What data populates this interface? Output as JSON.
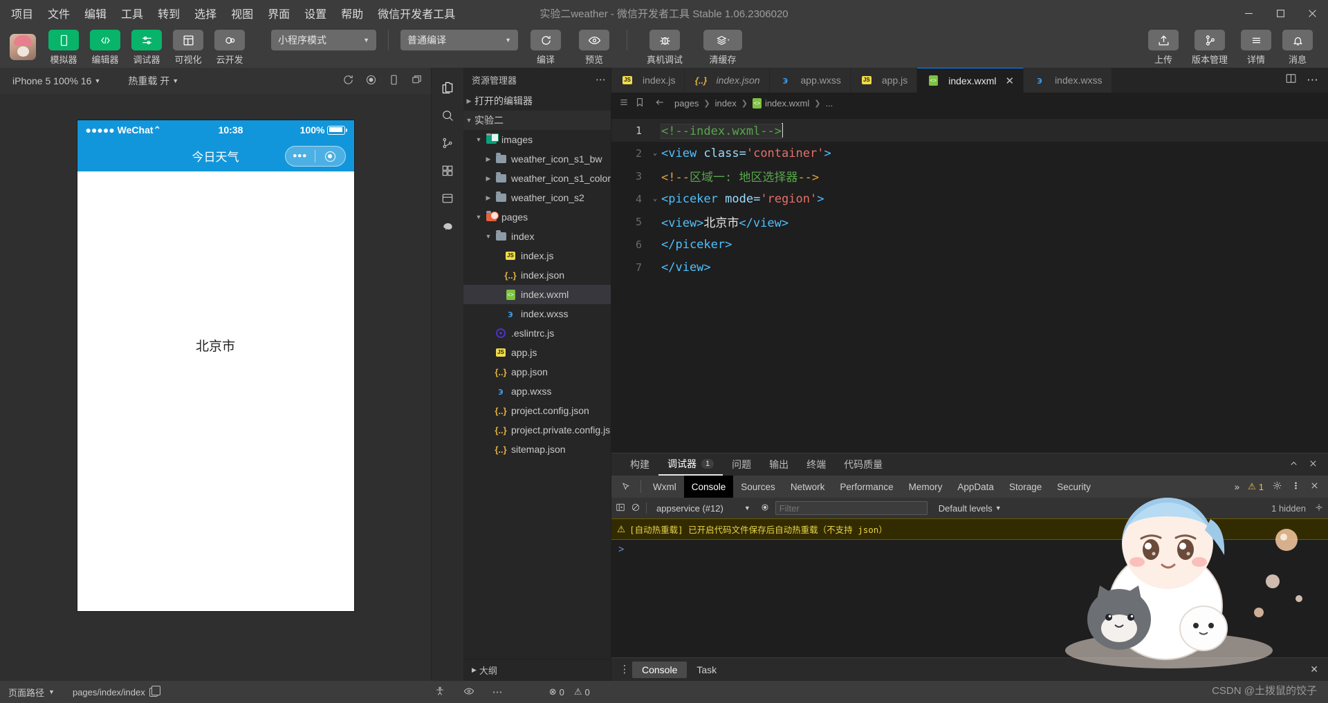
{
  "titlebar": {
    "menu": [
      "项目",
      "文件",
      "编辑",
      "工具",
      "转到",
      "选择",
      "视图",
      "界面",
      "设置",
      "帮助",
      "微信开发者工具"
    ],
    "title": "实验二weather - 微信开发者工具 Stable 1.06.2306020"
  },
  "toolbar": {
    "left_buttons": [
      {
        "label": "模拟器",
        "icon": "phone-icon",
        "style": "green"
      },
      {
        "label": "编辑器",
        "icon": "code-icon",
        "style": "green"
      },
      {
        "label": "调试器",
        "icon": "sliders-icon",
        "style": "green"
      },
      {
        "label": "可视化",
        "icon": "layout-icon",
        "style": "grey"
      },
      {
        "label": "云开发",
        "icon": "cloud-icon",
        "style": "grey"
      }
    ],
    "mode_select": "小程序模式",
    "compile_select": "普通编译",
    "action_buttons": [
      {
        "label": "编译",
        "icon": "refresh-icon"
      },
      {
        "label": "预览",
        "icon": "eye-icon"
      },
      {
        "label": "真机调试",
        "icon": "bug-icon"
      },
      {
        "label": "清缓存",
        "icon": "layers-icon"
      }
    ],
    "right_buttons": [
      {
        "label": "上传",
        "icon": "upload-icon"
      },
      {
        "label": "版本管理",
        "icon": "branch-icon"
      },
      {
        "label": "详情",
        "icon": "menu-icon"
      },
      {
        "label": "消息",
        "icon": "bell-icon"
      }
    ]
  },
  "simulator": {
    "device": "iPhone 5 100% 16",
    "hotreload": "热重载 开",
    "status_time": "10:38",
    "carrier": "WeChat",
    "battery": "100%",
    "nav_title": "今日天气",
    "page_text": "北京市"
  },
  "explorer": {
    "header": "资源管理器",
    "open_editors": "打开的编辑器",
    "project": "实验二",
    "outline": "大纲",
    "tree": [
      {
        "label": "images",
        "type": "folder-images",
        "depth": 1,
        "arrow": "down"
      },
      {
        "label": "weather_icon_s1_bw",
        "type": "folder",
        "depth": 2,
        "arrow": "right"
      },
      {
        "label": "weather_icon_s1_color",
        "type": "folder",
        "depth": 2,
        "arrow": "right"
      },
      {
        "label": "weather_icon_s2",
        "type": "folder",
        "depth": 2,
        "arrow": "right"
      },
      {
        "label": "pages",
        "type": "folder-pages",
        "depth": 1,
        "arrow": "down"
      },
      {
        "label": "index",
        "type": "folder-open",
        "depth": 2,
        "arrow": "down"
      },
      {
        "label": "index.js",
        "type": "js",
        "depth": 3,
        "arrow": "none"
      },
      {
        "label": "index.json",
        "type": "json",
        "depth": 3,
        "arrow": "none"
      },
      {
        "label": "index.wxml",
        "type": "wxml",
        "depth": 3,
        "arrow": "none",
        "selected": true
      },
      {
        "label": "index.wxss",
        "type": "wxss",
        "depth": 3,
        "arrow": "none"
      },
      {
        "label": ".eslintrc.js",
        "type": "eslint",
        "depth": 2,
        "arrow": "none"
      },
      {
        "label": "app.js",
        "type": "js",
        "depth": 2,
        "arrow": "none"
      },
      {
        "label": "app.json",
        "type": "json",
        "depth": 2,
        "arrow": "none"
      },
      {
        "label": "app.wxss",
        "type": "wxss",
        "depth": 2,
        "arrow": "none"
      },
      {
        "label": "project.config.json",
        "type": "json",
        "depth": 2,
        "arrow": "none"
      },
      {
        "label": "project.private.config.js...",
        "type": "json",
        "depth": 2,
        "arrow": "none"
      },
      {
        "label": "sitemap.json",
        "type": "json",
        "depth": 2,
        "arrow": "none"
      }
    ]
  },
  "editor": {
    "tabs": [
      {
        "label": "index.js",
        "type": "js",
        "active": false,
        "italic": false
      },
      {
        "label": "index.json",
        "type": "json",
        "active": false,
        "italic": true
      },
      {
        "label": "app.wxss",
        "type": "wxss",
        "active": false,
        "italic": false
      },
      {
        "label": "app.js",
        "type": "js",
        "active": false,
        "italic": false
      },
      {
        "label": "index.wxml",
        "type": "wxml",
        "active": true,
        "italic": false,
        "close": "✕"
      },
      {
        "label": "index.wxss",
        "type": "wxss",
        "active": false,
        "italic": false
      }
    ],
    "tabs_more": "⋯",
    "breadcrumb": [
      "pages",
      "index",
      "index.wxml",
      "..."
    ],
    "lines": [
      {
        "n": "1",
        "fold": "",
        "current": true,
        "tokens": [
          {
            "t": "<!--index.wxml-->",
            "c": "tk-com"
          }
        ]
      },
      {
        "n": "2",
        "fold": "⌄",
        "tokens": [
          {
            "t": "<view ",
            "c": "tk-tag"
          },
          {
            "t": "class=",
            "c": "tk-attr"
          },
          {
            "t": "'container'",
            "c": "tk-str"
          },
          {
            "t": ">",
            "c": "tk-tag"
          }
        ]
      },
      {
        "n": "3",
        "fold": "",
        "tokens": [
          {
            "t": "<!--",
            "c": "tk-comp"
          },
          {
            "t": "区域一: 地区选择器",
            "c": "tk-com"
          },
          {
            "t": "-->",
            "c": "tk-comp"
          }
        ]
      },
      {
        "n": "4",
        "fold": "⌄",
        "tokens": [
          {
            "t": "<piceker ",
            "c": "tk-tag"
          },
          {
            "t": "mode=",
            "c": "tk-attr"
          },
          {
            "t": "'region'",
            "c": "tk-str"
          },
          {
            "t": ">",
            "c": "tk-tag"
          }
        ]
      },
      {
        "n": "5",
        "fold": "",
        "tokens": [
          {
            "t": "<view>",
            "c": "tk-tag"
          },
          {
            "t": "北京市",
            "c": "tk-txt"
          },
          {
            "t": "</view>",
            "c": "tk-tag"
          }
        ]
      },
      {
        "n": "6",
        "fold": "",
        "tokens": [
          {
            "t": "</piceker>",
            "c": "tk-tag"
          }
        ]
      },
      {
        "n": "7",
        "fold": "",
        "tokens": [
          {
            "t": "</view>",
            "c": "tk-tag"
          }
        ]
      }
    ]
  },
  "devtools": {
    "panel_tabs": [
      {
        "label": "构建",
        "active": false
      },
      {
        "label": "调试器",
        "active": true,
        "count": "1"
      },
      {
        "label": "问题",
        "active": false
      },
      {
        "label": "输出",
        "active": false
      },
      {
        "label": "终端",
        "active": false
      },
      {
        "label": "代码质量",
        "active": false
      }
    ],
    "sub_tabs": [
      "Wxml",
      "Console",
      "Sources",
      "Network",
      "Performance",
      "Memory",
      "AppData",
      "Storage",
      "Security"
    ],
    "sub_active": "Console",
    "overflow": "»",
    "warn_count": "1",
    "context": "appservice (#12)",
    "filter_placeholder": "Filter",
    "levels": "Default levels",
    "hidden": "1 hidden",
    "console_warning": "[自动热重载] 已开启代码文件保存后自动热重载（不支持 json）",
    "prompt": ">",
    "footer_tabs": [
      {
        "label": "Console",
        "active": true
      },
      {
        "label": "Task",
        "active": false
      }
    ]
  },
  "statusbar": {
    "page_path_label": "页面路径",
    "path": "pages/index/index",
    "errors": "0",
    "warnings": "0",
    "watermark": "CSDN @土拨鼠的饺子"
  }
}
